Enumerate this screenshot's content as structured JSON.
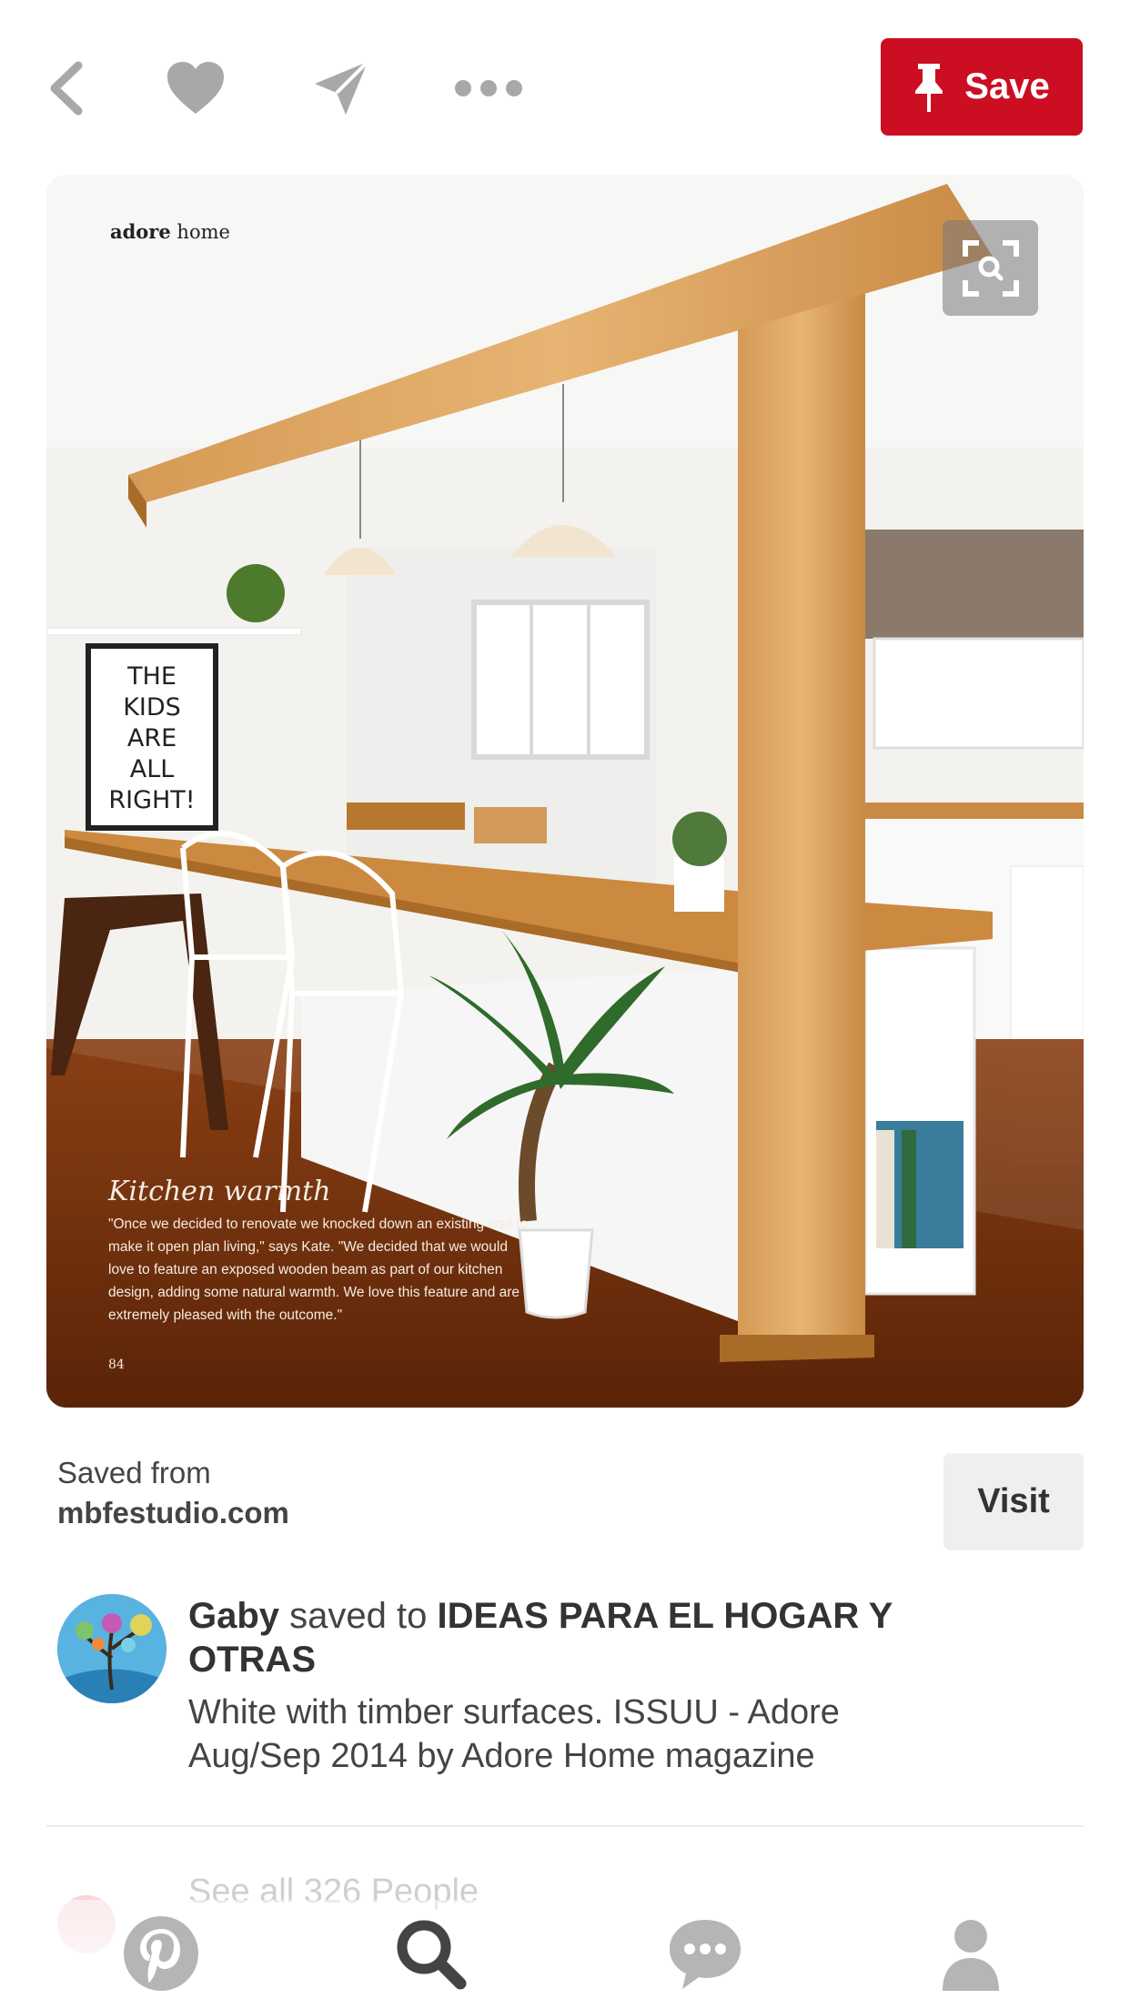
{
  "topbar": {
    "back_icon": "chevron-left-icon",
    "like_icon": "heart-icon",
    "send_icon": "paper-plane-icon",
    "more_icon": "ellipsis-icon",
    "save_label": "Save",
    "save_icon": "pushpin-icon"
  },
  "pin": {
    "zoom_icon": "visual-search-icon",
    "image_text": {
      "brand_bold": "adore",
      "brand_rest": "home",
      "poster_text": "THE KIDS ARE ALL RIGHT!",
      "caption_title": "Kitchen warmth",
      "caption_body": "\"Once we decided to renovate we knocked down an existing wall to make it open plan living,\" says Kate. \"We decided that we would love to feature an exposed wooden beam as part of our kitchen design, adding some natural warmth. We love this feature and are extremely pleased with the outcome.\"",
      "page_number": "84"
    }
  },
  "source": {
    "saved_from_label": "Saved from",
    "domain": "mbfestudio.com",
    "visit_label": "Visit"
  },
  "saver": {
    "name": "Gaby",
    "action": "saved to",
    "board": "IDEAS PARA EL HOGAR Y OTRAS",
    "description": "White with timber surfaces. ISSUU - Adore Aug/Sep 2014 by Adore Home magazine"
  },
  "see_all": {
    "text": "See all 326 People"
  },
  "tabbar": {
    "items": [
      {
        "name": "home",
        "icon": "pinterest-logo-icon"
      },
      {
        "name": "search",
        "icon": "search-icon",
        "active": true
      },
      {
        "name": "messages",
        "icon": "chat-bubble-icon"
      },
      {
        "name": "profile",
        "icon": "person-icon"
      }
    ]
  },
  "colors": {
    "brand_red": "#cc0e22",
    "icon_gray": "#a8a8a8",
    "text_dark": "#333333",
    "visit_bg": "#efefef"
  }
}
